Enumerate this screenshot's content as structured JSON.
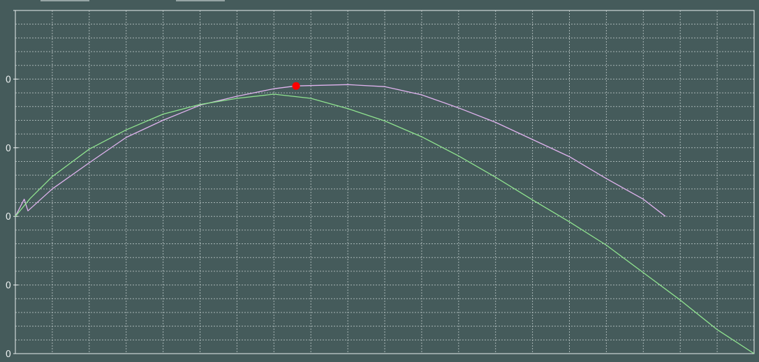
{
  "chart_data": {
    "type": "line",
    "title": "",
    "xlabel": "",
    "ylabel": "",
    "xlim": [
      0,
      100
    ],
    "ylim": [
      -4,
      1
    ],
    "grid": true,
    "y_tick_values": [
      -4,
      -3,
      -2,
      -1,
      0,
      1
    ],
    "y_tick_labels": [
      "0",
      "0",
      "0",
      "0",
      "0",
      ""
    ],
    "series": [
      {
        "color": "#e0b3ef",
        "points": [
          [
            0,
            -2
          ],
          [
            1.2,
            -1.75
          ],
          [
            1.7,
            -1.92
          ],
          [
            5,
            -1.6
          ],
          [
            10,
            -1.22
          ],
          [
            15,
            -0.85
          ],
          [
            20,
            -0.6
          ],
          [
            25,
            -0.38
          ],
          [
            30,
            -0.25
          ],
          [
            35,
            -0.14
          ],
          [
            38,
            -0.1
          ],
          [
            45,
            -0.08
          ],
          [
            50,
            -0.11
          ],
          [
            55,
            -0.23
          ],
          [
            60,
            -0.42
          ],
          [
            65,
            -0.63
          ],
          [
            70,
            -0.88
          ],
          [
            75,
            -1.13
          ],
          [
            80,
            -1.45
          ],
          [
            85,
            -1.75
          ],
          [
            88,
            -2
          ]
        ]
      },
      {
        "color": "#8fe38f",
        "points": [
          [
            0,
            -2
          ],
          [
            2,
            -1.74
          ],
          [
            5,
            -1.42
          ],
          [
            10,
            -1.02
          ],
          [
            15,
            -0.74
          ],
          [
            20,
            -0.51
          ],
          [
            25,
            -0.37
          ],
          [
            30,
            -0.28
          ],
          [
            35,
            -0.22
          ],
          [
            40,
            -0.28
          ],
          [
            45,
            -0.43
          ],
          [
            50,
            -0.61
          ],
          [
            55,
            -0.84
          ],
          [
            60,
            -1.12
          ],
          [
            65,
            -1.43
          ],
          [
            70,
            -1.76
          ],
          [
            75,
            -2.08
          ],
          [
            80,
            -2.42
          ],
          [
            85,
            -2.82
          ],
          [
            90,
            -3.22
          ],
          [
            95,
            -3.65
          ],
          [
            100,
            -4
          ]
        ]
      }
    ],
    "marker": {
      "x": 38,
      "y": -0.1,
      "color": "#ff0000"
    },
    "colors": {
      "background": "#455b5b",
      "grid": "#b8c4c4",
      "axis": "#e8eded"
    }
  }
}
